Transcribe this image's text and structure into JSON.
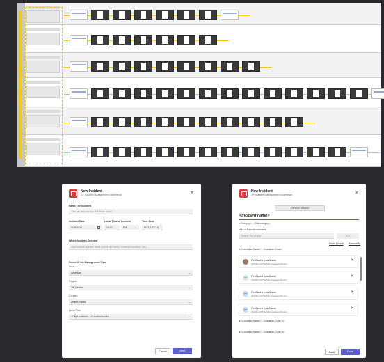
{
  "board": {
    "side_label": "IMX Testing: Flows"
  },
  "new_incident": {
    "title": "New Incident",
    "subtitle": "EY Incident Management Experience",
    "name_label": "Name The Incident",
    "name_placeholder": "This will become the IMX team name",
    "date_label": "Incident Date",
    "date_value": "9/10/2022",
    "time_label": "Local Time of Incident",
    "time_value": "12:07",
    "ampm_value": "PM",
    "tz_label": "Time Zone",
    "tz_value": "EDT (UTC-4)",
    "where_label": "Where Incident Occured",
    "where_placeholder": "Add location specific detail (client site name, unnamed location, etc.)",
    "plan_heading": "Select Crisis Management Plan",
    "area_label": "Area",
    "area_value": "Americas",
    "region_label": "Region",
    "region_value": "US Central",
    "country_label": "Country",
    "country_value": "United States",
    "local_plan_label": "Local Plan",
    "local_plan_value": "<City Location> - <Location code>",
    "cancel_label": "Cancel",
    "next_label": "Next"
  },
  "incident_members": {
    "title": "New Incident",
    "subtitle": "EY Incident Management Experience",
    "tab_label": "General Incident",
    "incident_name": "<Incident name>",
    "category_line": "<Category> - <Sub-category>",
    "add_remove_label": "Add or Remove members",
    "search_placeholder": "Search for people",
    "add_label": "Add",
    "reset_label": "Reset Default",
    "remove_all_label": "Remove All",
    "group1": "<Location Name> - <Location Code>",
    "members": [
      {
        "initials": "",
        "name": "FirstName LastName",
        "role": "(NAME LASTNAME) Assistant Director",
        "avatar": "photo"
      },
      {
        "initials": "AV",
        "name": "FirstName LastName",
        "role": "(NAME LASTNAME) Assistant Director",
        "avatar": "green"
      },
      {
        "initials": "AV",
        "name": "FirstName LastName",
        "role": "(NAME LASTNAME) Assistant Director",
        "avatar": "blue"
      },
      {
        "initials": "AV",
        "name": "FirstName LastName",
        "role": "(NAME LASTNAME) Assistant Director",
        "avatar": "blue"
      }
    ],
    "group2": "<Location Name> - <Location Code 2>",
    "group3": "<Location Name> - <Location Code n>",
    "back_label": "Back",
    "done_label": "Done"
  },
  "colors": {
    "accent": "#5b5fc7",
    "flow_highlight": "#f2c811",
    "app_icon": "#d83b3b",
    "background": "#2a2a2e"
  }
}
